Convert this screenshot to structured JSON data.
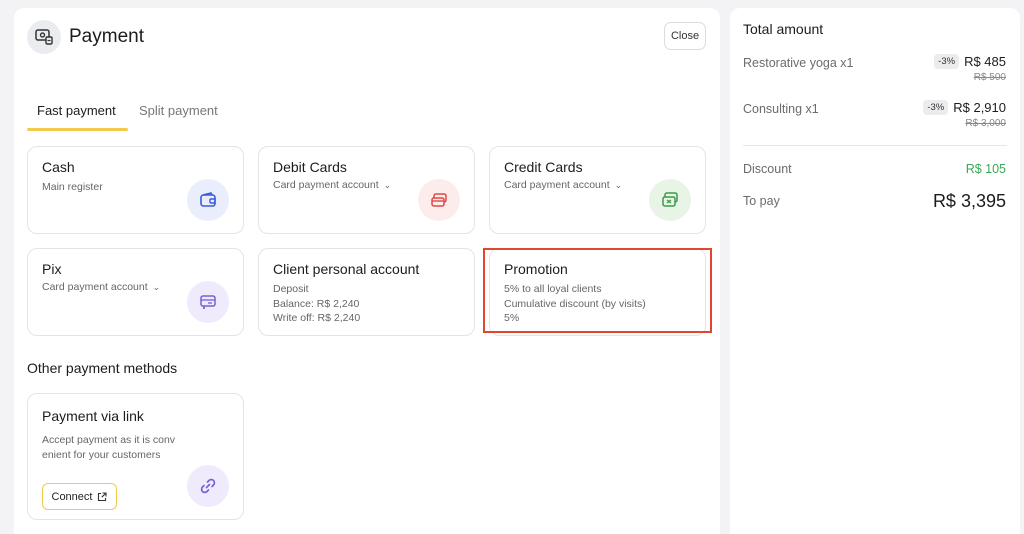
{
  "header": {
    "title": "Payment",
    "close_label": "Close",
    "icon": "cash-register-icon"
  },
  "tabs": [
    {
      "label": "Fast payment",
      "active": true
    },
    {
      "label": "Split payment",
      "active": false
    }
  ],
  "methods": [
    {
      "title": "Cash",
      "sub": "Main register",
      "icon": "wallet-icon"
    },
    {
      "title": "Debit Cards",
      "sub": "Card payment account",
      "icon": "card-icon"
    },
    {
      "title": "Credit Cards",
      "sub": "Card payment account",
      "icon": "credit-card-icon"
    },
    {
      "title": "Pix",
      "sub": "Card payment account",
      "icon": "pix-icon"
    },
    {
      "title": "Client personal account",
      "lines": [
        "Deposit",
        "Balance: R$ 2,240",
        "Write off: R$ 2,240"
      ]
    },
    {
      "title": "Promotion",
      "lines": [
        "5% to all loyal clients",
        "Cumulative discount (by visits)",
        "5%"
      ]
    }
  ],
  "other": {
    "title": "Other payment methods",
    "link": {
      "title": "Payment via link",
      "desc": "Accept payment as it is conv enient for your customers",
      "connect_label": "Connect",
      "icon": "link-icon"
    }
  },
  "summary": {
    "title": "Total amount",
    "items": [
      {
        "name": "Restorative yoga  x1",
        "badge": "-3%",
        "price": "R$ 485",
        "old_price": "R$ 500"
      },
      {
        "name": "Consulting  x1",
        "badge": "-3%",
        "price": "R$ 2,910",
        "old_price": "R$ 3,000"
      }
    ],
    "discount_label": "Discount",
    "discount_value": "R$ 105",
    "topay_label": "To pay",
    "topay_value": "R$ 3,395"
  },
  "colors": {
    "accent": "#f2c94c",
    "highlight": "#e0472f",
    "discount": "#3aa857"
  }
}
